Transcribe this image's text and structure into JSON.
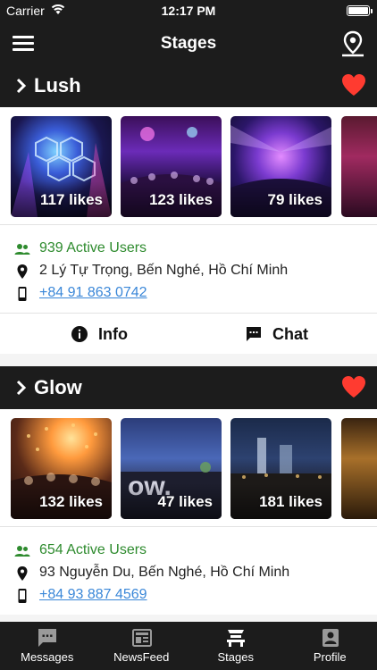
{
  "status": {
    "carrier": "Carrier",
    "time": "12:17 PM"
  },
  "header": {
    "title": "Stages",
    "menu_icon": "hamburger-menu-icon",
    "map_icon": "map-pin-icon"
  },
  "stages": [
    {
      "name": "Lush",
      "favorite": true,
      "photos": [
        {
          "likes": "117 likes"
        },
        {
          "likes": "123 likes"
        },
        {
          "likes": "79 likes"
        }
      ],
      "active_users": "939 Active Users",
      "address": "2 Lý Tự Trọng, Bến Nghé, Hồ Chí Minh",
      "phone": "+84 91 863 0742",
      "info_label": "Info",
      "chat_label": "Chat"
    },
    {
      "name": "Glow",
      "favorite": true,
      "photos": [
        {
          "likes": "132 likes"
        },
        {
          "likes": "47 likes"
        },
        {
          "likes": "181 likes"
        }
      ],
      "active_users": "654 Active Users",
      "address": "93 Nguyễn Du, Bến Nghé, Hồ Chí Minh",
      "phone": "+84 93 887 4569"
    }
  ],
  "tabs": [
    {
      "label": "Messages",
      "icon": "chat-bubble-icon"
    },
    {
      "label": "NewsFeed",
      "icon": "newspaper-icon"
    },
    {
      "label": "Stages",
      "icon": "stage-icon"
    },
    {
      "label": "Profile",
      "icon": "person-badge-icon"
    }
  ],
  "colors": {
    "bar": "#1c1c1c",
    "heart": "#ff3b30",
    "users": "#2e8b2e",
    "link": "#3a87d8"
  }
}
